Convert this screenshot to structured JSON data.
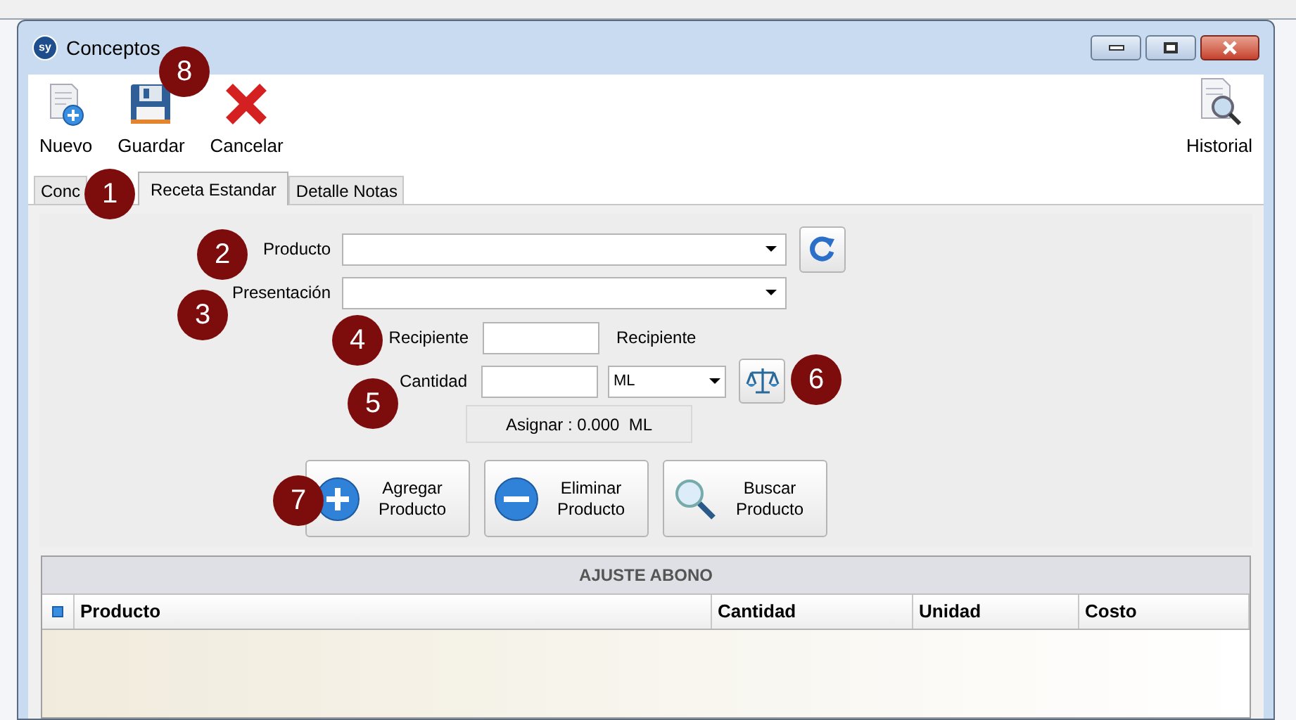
{
  "window": {
    "title": "Conceptos",
    "logo_text": "sy"
  },
  "toolbar": [
    {
      "label": "Nuevo",
      "kind": "new"
    },
    {
      "label": "Guardar",
      "kind": "save"
    },
    {
      "label": "Cancelar",
      "kind": "cancel"
    },
    {
      "label": "Historial",
      "kind": "history"
    }
  ],
  "tabs": [
    {
      "label": "Conc",
      "selected": false
    },
    {
      "label": "Receta Estandar",
      "selected": true
    },
    {
      "label": "Detalle Notas",
      "selected": false
    }
  ],
  "form": {
    "producto_label": "Producto",
    "presentacion_label": "Presentación",
    "recipiente_label": "Recipiente",
    "recipiente_unit": "Recipiente",
    "cantidad_label": "Cantidad",
    "unit_value": "ML",
    "assigned": "Asignar : 0.000  ML"
  },
  "actions": [
    {
      "label": "Agregar Producto",
      "kind": "add"
    },
    {
      "label": "Eliminar Producto",
      "kind": "remove"
    },
    {
      "label": "Buscar Producto",
      "kind": "search"
    }
  ],
  "grid": {
    "title": "AJUSTE ABONO",
    "select_all": {
      "checked": false
    },
    "columns": [
      "Producto",
      "Cantidad",
      "Unidad",
      "Costo"
    ]
  },
  "callouts": [
    "8",
    "1",
    "2",
    "3",
    "4",
    "5",
    "6",
    "7"
  ]
}
